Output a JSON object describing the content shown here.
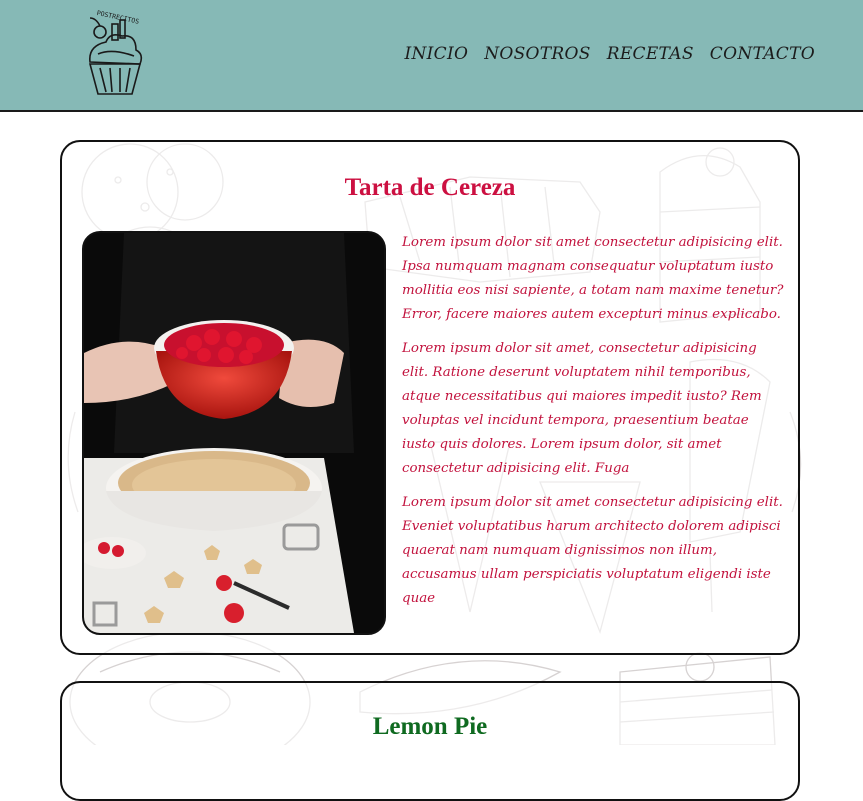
{
  "header": {
    "logo_text": "POSTRECITOS",
    "nav": [
      "INICIO",
      "NOSOTROS",
      "RECETAS",
      "CONTACTO"
    ]
  },
  "recipes": [
    {
      "title": "Tarta de Cereza",
      "image": "cherry-pie-photo",
      "paragraphs": [
        "Lorem ipsum dolor sit amet consectetur adipisicing elit. Ipsa numquam magnam consequatur voluptatum iusto mollitia eos nisi sapiente, a totam nam maxime tenetur? Error, facere maiores autem excepturi minus explicabo.",
        "Lorem ipsum dolor sit amet, consectetur adipisicing elit. Ratione deserunt voluptatem nihil temporibus, atque necessitatibus qui maiores impedit iusto? Rem voluptas vel incidunt tempora, praesentium beatae iusto quis dolores. Lorem ipsum dolor, sit amet consectetur adipisicing elit. Fuga",
        "Lorem ipsum dolor sit amet consectetur adipisicing elit. Eveniet voluptatibus harum architecto dolorem adipisci quaerat nam numquam dignissimos non illum, accusamus ullam perspiciatis voluptatum eligendi iste quae"
      ]
    },
    {
      "title": "Lemon Pie"
    }
  ],
  "colors": {
    "header_bg": "#86b9b6",
    "title_red": "#cc1041",
    "text_red": "#c2123d",
    "title_green": "#0f6a20"
  }
}
